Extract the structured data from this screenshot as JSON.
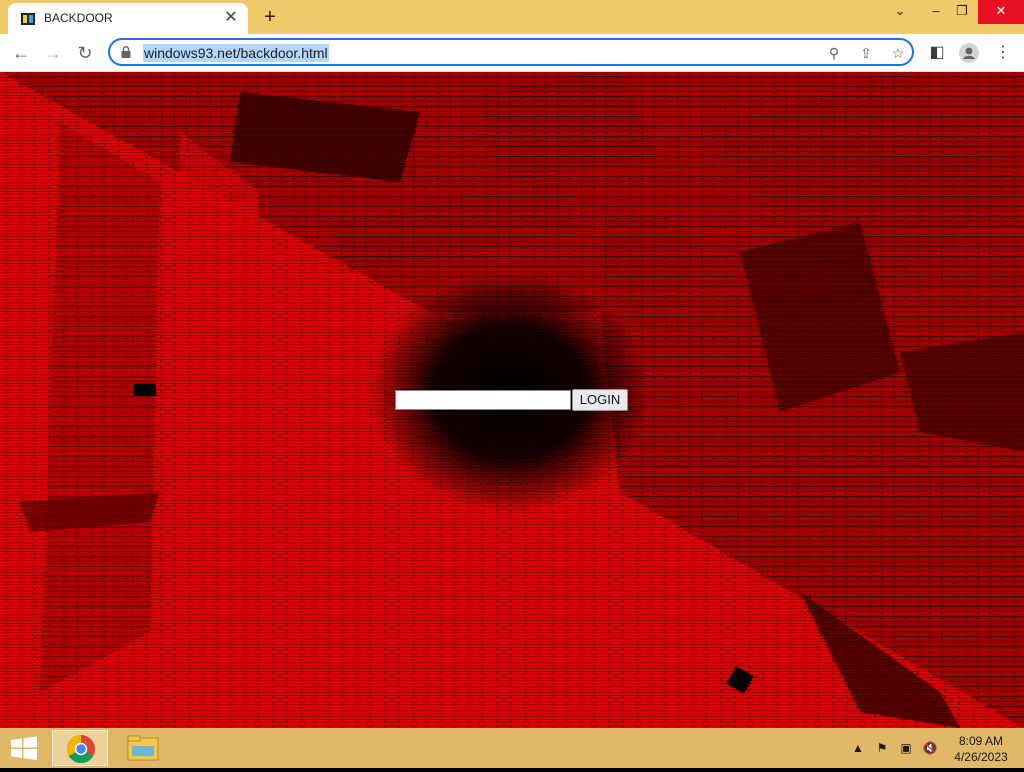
{
  "browser": {
    "tab": {
      "title": "BACKDOOR",
      "favicon": "windows93-icon"
    },
    "new_tab_label": "+",
    "url": "windows93.net/backdoor.html"
  },
  "page": {
    "login_input": {
      "value": "",
      "placeholder": ""
    },
    "login_button": "LOGIN",
    "theme": {
      "wall": "#e10000",
      "mortar": "#5a0000",
      "void": "#000000"
    }
  },
  "taskbar": {
    "apps": [
      "chrome-icon",
      "file-explorer-icon"
    ],
    "tray": [
      "show-hidden-icons",
      "action-center-flag-icon",
      "network-icon",
      "volume-muted-icon"
    ],
    "time": "8:09 AM",
    "date": "4/26/2023"
  }
}
